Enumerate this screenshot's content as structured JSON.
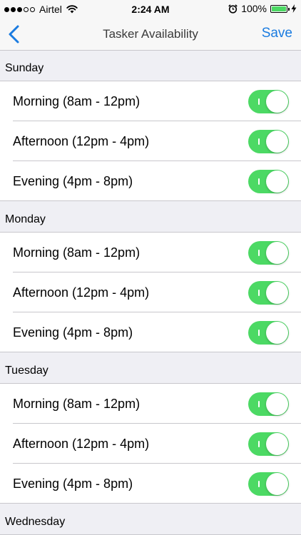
{
  "status_bar": {
    "carrier": "Airtel",
    "time": "2:24 AM",
    "battery_percent": "100%",
    "battery_level": 1.0,
    "battery_color": "#4cd964"
  },
  "nav": {
    "title": "Tasker Availability",
    "save_label": "Save",
    "back_icon": "chevron-left-icon",
    "accent_color": "#1a7be0"
  },
  "toggle_on_color": "#4cd964",
  "sections": [
    {
      "day": "Sunday",
      "slots": [
        {
          "label": "Morning (8am - 12pm)",
          "on": true
        },
        {
          "label": "Afternoon (12pm - 4pm)",
          "on": true
        },
        {
          "label": "Evening (4pm - 8pm)",
          "on": true
        }
      ]
    },
    {
      "day": "Monday",
      "slots": [
        {
          "label": "Morning (8am - 12pm)",
          "on": true
        },
        {
          "label": "Afternoon (12pm - 4pm)",
          "on": true
        },
        {
          "label": "Evening (4pm - 8pm)",
          "on": true
        }
      ]
    },
    {
      "day": "Tuesday",
      "slots": [
        {
          "label": "Morning (8am - 12pm)",
          "on": true
        },
        {
          "label": "Afternoon (12pm - 4pm)",
          "on": true
        },
        {
          "label": "Evening (4pm - 8pm)",
          "on": true
        }
      ]
    },
    {
      "day": "Wednesday",
      "slots": []
    }
  ]
}
